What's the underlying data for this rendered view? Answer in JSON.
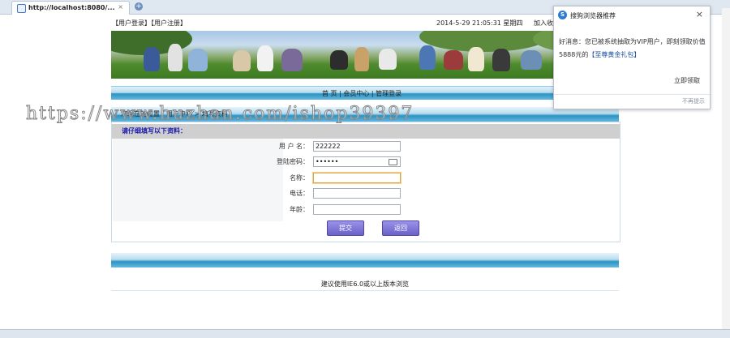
{
  "browser": {
    "tab_title": "http://localhost:8080/...",
    "tab_close": "×",
    "new_tab": "+"
  },
  "topbar": {
    "login": "【用户登录】",
    "register": "【用户注册】",
    "datetime": "2014-5-29 21:05:31  星期四",
    "add_favorite": "加入收"
  },
  "nav": {
    "home": "首 页",
    "sep1": " | ",
    "member": "会员中心",
    "sep2": " | ",
    "admin": "管理登录"
  },
  "breadcrumb": "您现在的位置：用户中心 > 填写资料",
  "watermark": "https://www.huzhan.com/ishop39397",
  "form": {
    "heading": "请仔细填写以下资料：",
    "fields": [
      {
        "label": "用 户 名：",
        "value": "222222"
      },
      {
        "label": "登陆密码：",
        "value": "••••••"
      },
      {
        "label": "名称：",
        "value": ""
      },
      {
        "label": "电话：",
        "value": ""
      },
      {
        "label": "年龄：",
        "value": ""
      }
    ],
    "submit": "提交",
    "back": "返回"
  },
  "footer": "建议使用IE6.0或以上版本浏览",
  "popup": {
    "title": "搜狗浏览器推荐",
    "close": "×",
    "message_prefix": "好消息：您已被系统抽取为VIP用户，即刻领取价值5888元的",
    "message_highlight": "【至尊黄金礼包】",
    "claim": "立即领取",
    "no_more": "不再提示"
  },
  "colors": {
    "bar_blue": "#2a93c4",
    "button": "#6b60c9",
    "heading_text": "#1b1bb0"
  }
}
